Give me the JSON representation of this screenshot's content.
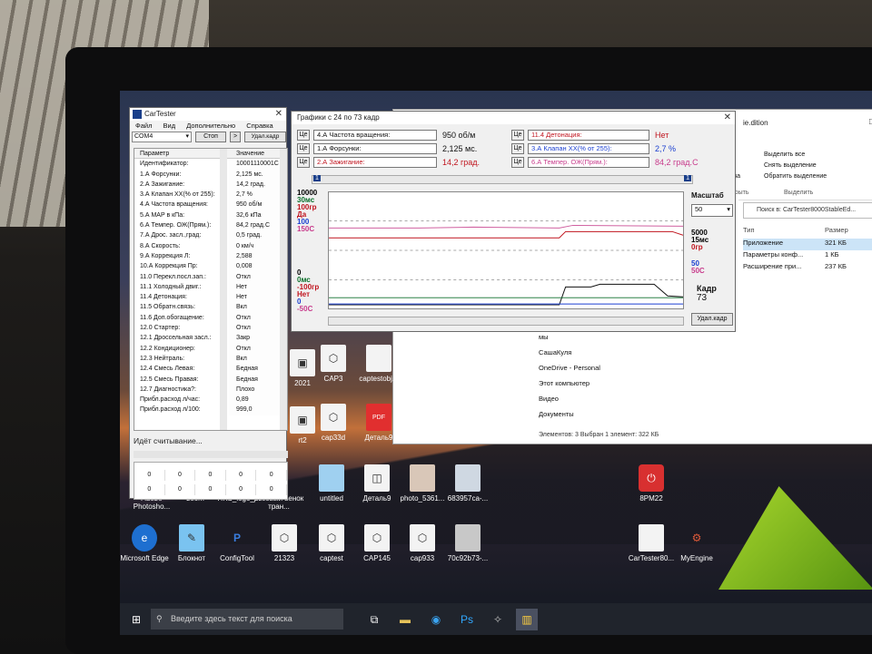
{
  "cartester": {
    "title": "CarTester",
    "menu": [
      "Файл",
      "Вид",
      "Дополнительно",
      "Справка"
    ],
    "port": "COM4",
    "stop_label": "Стоп",
    "arrow": ">",
    "clear_label": "Удал.кадр",
    "headers": {
      "param": "Параметр",
      "value": "Значение"
    },
    "rows": [
      {
        "name": "Идентификатор:",
        "value": "10001110001C"
      },
      {
        "name": "1.А Форсунки:",
        "value": "2,125 мс."
      },
      {
        "name": "2.А Зажигание:",
        "value": "14,2 град."
      },
      {
        "name": "3.А Клапан ХХ(% от 255):",
        "value": "2,7 %"
      },
      {
        "name": "4.А Частота вращения:",
        "value": "950 об/м"
      },
      {
        "name": "5.А MAP в кПа:",
        "value": "32,6 кПа"
      },
      {
        "name": "6.А Темпер. ОЖ(Прям.):",
        "value": "84,2 град.С"
      },
      {
        "name": "7.А Дрос. засл.,град:",
        "value": "0,5 град."
      },
      {
        "name": "8.А Скорость:",
        "value": "0 км/ч"
      },
      {
        "name": "9.А Коррекция Л:",
        "value": "2,588"
      },
      {
        "name": "10.А Коррекция Пр:",
        "value": "0,008"
      },
      {
        "name": "11.0 Перекл.посл.зап.:",
        "value": "Откл"
      },
      {
        "name": "11.1 Холодный двиг.:",
        "value": "Нет"
      },
      {
        "name": "11.4 Детонация:",
        "value": "Нет"
      },
      {
        "name": "11.5 Обратн.связь:",
        "value": "Вкл"
      },
      {
        "name": "11.6 Доп.обогащение:",
        "value": "Откл"
      },
      {
        "name": "12.0 Стартер:",
        "value": "Откл"
      },
      {
        "name": "12.1 Дроссельная засл.:",
        "value": "Закр"
      },
      {
        "name": "12.2 Кондиционер:",
        "value": "Откл"
      },
      {
        "name": "12.3 Нейтраль:",
        "value": "Вкл"
      },
      {
        "name": "12.4 Смесь Левая:",
        "value": "Бедная"
      },
      {
        "name": "12.5 Смесь Правая:",
        "value": "Бедная"
      },
      {
        "name": "12.7 Диагностика?:",
        "value": "Плохо"
      },
      {
        "name": "Прибл.расход л/час:",
        "value": "0,89"
      },
      {
        "name": "Прибл.расход л/100:",
        "value": "999,0"
      }
    ],
    "status": "Идёт считывание...",
    "mini_rows": [
      [
        "0",
        "0",
        "0",
        "0",
        "0"
      ],
      [
        "0",
        "0",
        "0",
        "0",
        "0"
      ]
    ]
  },
  "graph": {
    "title": "Графики  с 24 по 73 кадр",
    "ce": "Це",
    "left_params": [
      {
        "label": "4.А  Частота вращения:",
        "value": "950 об/м",
        "color": "#000000"
      },
      {
        "label": "1.А  Форсунки:",
        "value": "2,125 мс.",
        "color": "#000000"
      },
      {
        "label": "2.А  Зажигание:",
        "value": "14,2 град.",
        "color": "#c0141e"
      }
    ],
    "right_params": [
      {
        "label": "11.4  Детонация:",
        "value": "Нет",
        "color": "#c0141e"
      },
      {
        "label": "3.А  Клапан ХХ(% от 255):",
        "value": "2,7 %",
        "color": "#1a3fd0"
      },
      {
        "label": "6.А  Темпер. ОЖ(Прям.):",
        "value": "84,2 град.С",
        "color": "#c83c8c"
      }
    ],
    "scale_label": "Масштаб",
    "scale_value": "50",
    "y_top": [
      "10000",
      "30мс",
      "100гр",
      "Да",
      "100",
      "150С"
    ],
    "y_bottom": [
      "0",
      "0мс",
      "-100гр",
      "Нет",
      "0",
      "-50С"
    ],
    "right_top": [
      "5000",
      "15мс",
      "0гр"
    ],
    "right_mid": [
      "50",
      "50С"
    ],
    "frame_label": "Кадр",
    "frame_value": "73",
    "clear_label": "Удал.кадр",
    "scroll_left": "1",
    "scroll_right": "1"
  },
  "desktop": {
    "icons": [
      {
        "label": "2021"
      },
      {
        "label": "CAP3"
      },
      {
        "label": "captestobj..."
      },
      {
        "label": "rt2"
      },
      {
        "label": "cap33d"
      },
      {
        "label": "Деталь9"
      },
      {
        "label": "Adobe Photosho..."
      },
      {
        "label": "zoom"
      },
      {
        "label": "HKS_logo_..."
      },
      {
        "label": "розовый венок тран..."
      },
      {
        "label": "untitled"
      },
      {
        "label": "Деталь9"
      },
      {
        "label": "photo_5361..."
      },
      {
        "label": "683957ca-..."
      },
      {
        "label": "Microsoft Edge"
      },
      {
        "label": "Блокнот"
      },
      {
        "label": "ConfigTool"
      },
      {
        "label": "21323"
      },
      {
        "label": "captest"
      },
      {
        "label": "CAP145"
      },
      {
        "label": "cap933"
      },
      {
        "label": "70c92b73-..."
      },
      {
        "label": "8PM22"
      },
      {
        "label": "CarTester80..."
      },
      {
        "label": "MyEngine"
      },
      {
        "label": "242"
      }
    ],
    "pdf_badge": "PDF"
  },
  "explorer": {
    "title_fragment": "ie.dition",
    "ribbon": {
      "select_all": "Выделить все",
      "clear_sel": "Снять выделение",
      "invert_sel": "Обратить выделение",
      "group_select": "Выделить",
      "group_open": "Открыть",
      "group_props": "ойства"
    },
    "search_placeholder": "Поиск в: CarTester8000StableEd...",
    "columns": {
      "type": "Тип",
      "size": "Размер"
    },
    "files": [
      {
        "type": "Приложение",
        "size": "321 КБ"
      },
      {
        "type": "Параметры конф...",
        "size": "1 КБ"
      },
      {
        "type": "Расширение при...",
        "size": "237 КБ"
      }
    ],
    "nav": [
      "мы",
      "СашаКуля",
      "OneDrive - Personal",
      "Этот компьютер",
      "Видео",
      "Документы"
    ],
    "status": "Элементов: 3    Выбран 1 элемент: 322 КБ"
  },
  "taskbar": {
    "search_placeholder": "Введите здесь текст для поиска"
  }
}
